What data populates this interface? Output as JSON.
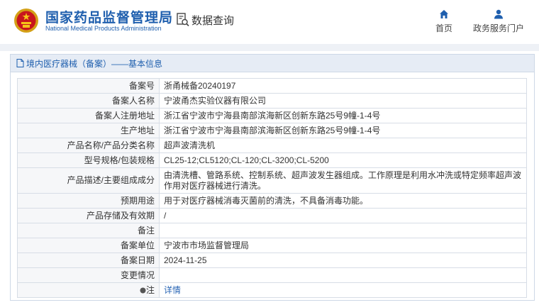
{
  "header": {
    "brand_cn": "国家药品监督管理局",
    "brand_en": "National Medical Products Administration",
    "query_label": "数据查询",
    "nav": [
      {
        "label": "首页",
        "icon": "home-icon"
      },
      {
        "label": "政务服务门户",
        "icon": "user-icon"
      }
    ]
  },
  "panel": {
    "title": "境内医疗器械（备案）——基本信息",
    "rows": [
      {
        "label": "备案号",
        "value": "浙甬械备20240197"
      },
      {
        "label": "备案人名称",
        "value": "宁波甬杰实验仪器有限公司"
      },
      {
        "label": "备案人注册地址",
        "value": "浙江省宁波市宁海县南部滨海新区创新东路25号9幢-1-4号"
      },
      {
        "label": "生产地址",
        "value": "浙江省宁波市宁海县南部滨海新区创新东路25号9幢-1-4号"
      },
      {
        "label": "产品名称/产品分类名称",
        "value": "超声波清洗机"
      },
      {
        "label": "型号规格/包装规格",
        "value": "CL25-12;CL5120;CL-120;CL-3200;CL-5200"
      },
      {
        "label": "产品描述/主要组成成分",
        "value": "由清洗槽、管路系统、控制系统、超声波发生器组成。工作原理是利用水冲洗或特定频率超声波作用对医疗器械进行清洗。"
      },
      {
        "label": "预期用途",
        "value": "用于对医疗器械消毒灭菌前的清洗，不具备消毒功能。"
      },
      {
        "label": "产品存储及有效期",
        "value": "/"
      },
      {
        "label": "备注",
        "value": ""
      },
      {
        "label": "备案单位",
        "value": "宁波市市场监督管理局"
      },
      {
        "label": "备案日期",
        "value": "2024-11-25"
      },
      {
        "label": "变更情况",
        "value": ""
      },
      {
        "label": "注",
        "value": "详情"
      }
    ]
  },
  "colors": {
    "brand_blue": "#1f5fae",
    "link_blue": "#2a66b5",
    "label_bg": "#f6f7f9",
    "title_bg": "#e6ecf5"
  }
}
